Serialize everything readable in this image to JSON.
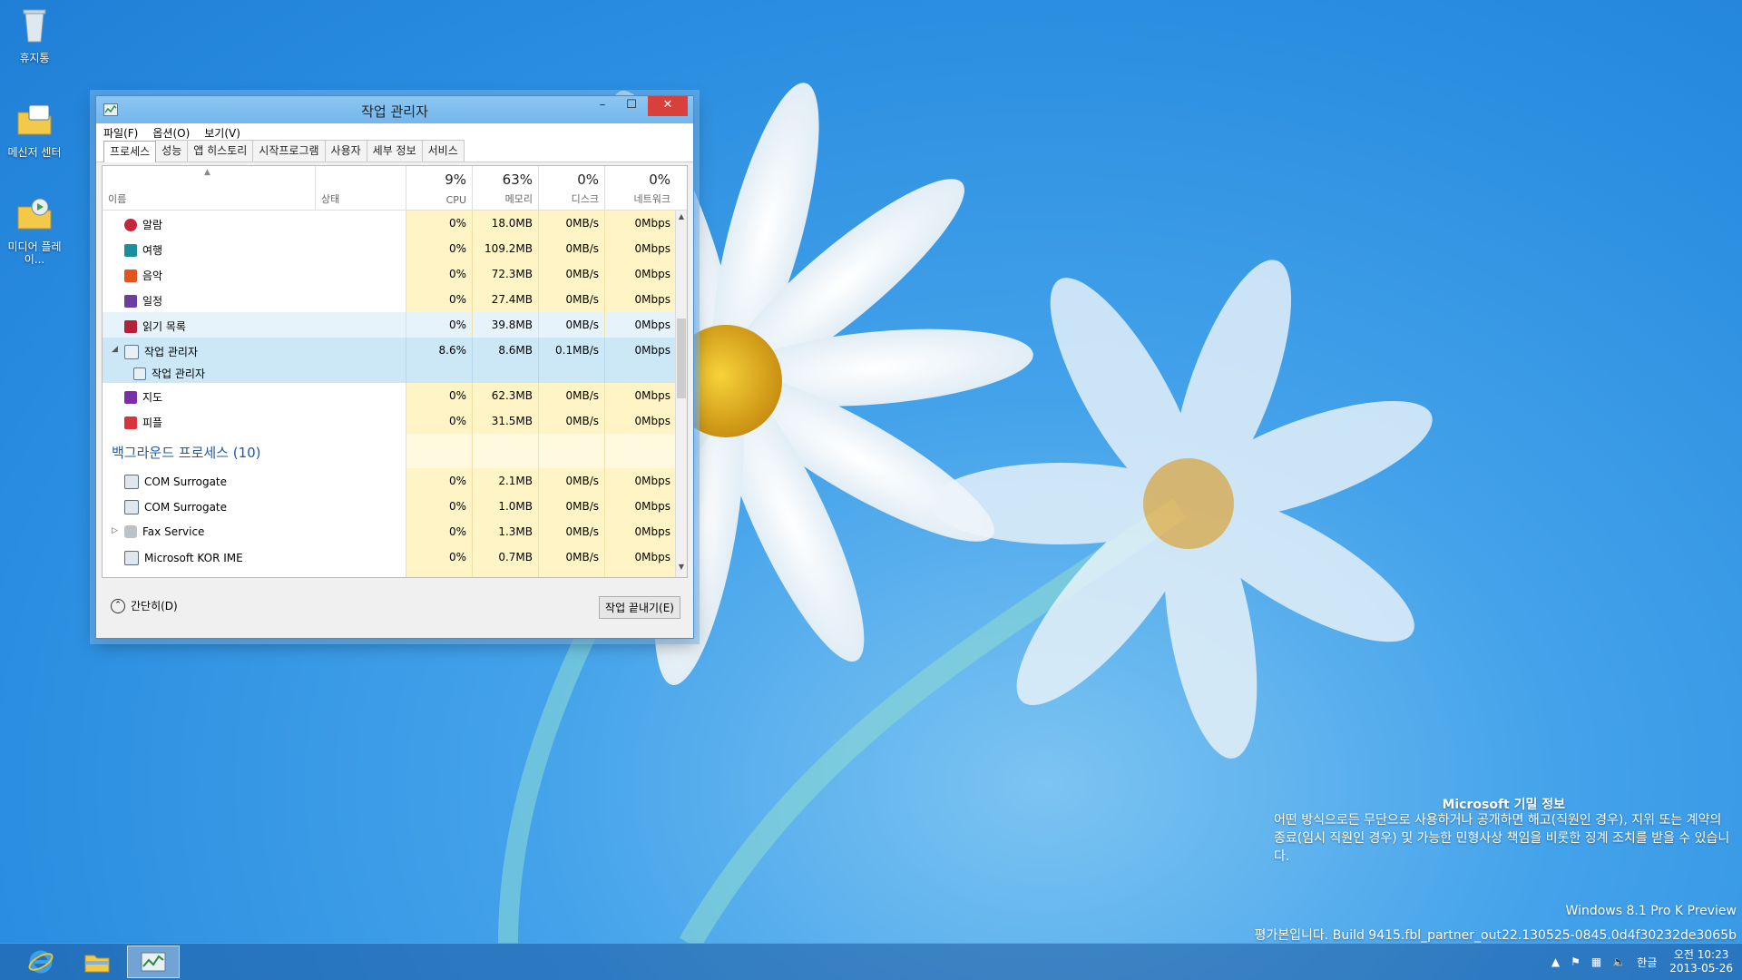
{
  "desktop": {
    "icons": [
      {
        "label": "휴지통",
        "icon": "recycle-bin-icon"
      },
      {
        "label": "메신저 센터",
        "icon": "messenger-center-icon"
      },
      {
        "label": "미디어 플레이...",
        "icon": "media-player-icon"
      }
    ]
  },
  "window": {
    "title": "작업 관리자",
    "controls": {
      "minimize": "–",
      "maximize": "☐",
      "close": "✕"
    },
    "menu": [
      "파일(F)",
      "옵션(O)",
      "보기(V)"
    ],
    "tabs": [
      "프로세스",
      "성능",
      "앱 히스토리",
      "시작프로그램",
      "사용자",
      "세부 정보",
      "서비스"
    ],
    "columns": {
      "name": "이름",
      "status": "상태",
      "cpu": {
        "pct": "9%",
        "label": "CPU"
      },
      "memory": {
        "pct": "63%",
        "label": "메모리"
      },
      "disk": {
        "pct": "0%",
        "label": "디스크"
      },
      "network": {
        "pct": "0%",
        "label": "네트워크"
      }
    },
    "apps": [
      {
        "name": "알람",
        "cpu": "0%",
        "mem": "18.0MB",
        "disk": "0MB/s",
        "net": "0Mbps",
        "color": "#c4263c"
      },
      {
        "name": "여행",
        "cpu": "0%",
        "mem": "109.2MB",
        "disk": "0MB/s",
        "net": "0Mbps",
        "color": "#1a8f9e"
      },
      {
        "name": "음악",
        "cpu": "0%",
        "mem": "72.3MB",
        "disk": "0MB/s",
        "net": "0Mbps",
        "color": "#e2541b"
      },
      {
        "name": "일정",
        "cpu": "0%",
        "mem": "27.4MB",
        "disk": "0MB/s",
        "net": "0Mbps",
        "color": "#6b3fa0"
      },
      {
        "name": "읽기 목록",
        "cpu": "0%",
        "mem": "39.8MB",
        "disk": "0MB/s",
        "net": "0Mbps",
        "color": "#b3223a"
      },
      {
        "name": "작업 관리자",
        "cpu": "8.6%",
        "mem": "8.6MB",
        "disk": "0.1MB/s",
        "net": "0Mbps",
        "color": "#7a9cc0",
        "child": "작업 관리자"
      },
      {
        "name": "지도",
        "cpu": "0%",
        "mem": "62.3MB",
        "disk": "0MB/s",
        "net": "0Mbps",
        "color": "#7a2fa8"
      },
      {
        "name": "피플",
        "cpu": "0%",
        "mem": "31.5MB",
        "disk": "0MB/s",
        "net": "0Mbps",
        "color": "#d6343f"
      }
    ],
    "background_section": "백그라운드 프로세스 (10)",
    "background": [
      {
        "name": "COM Surrogate",
        "cpu": "0%",
        "mem": "2.1MB",
        "disk": "0MB/s",
        "net": "0Mbps"
      },
      {
        "name": "COM Surrogate",
        "cpu": "0%",
        "mem": "1.0MB",
        "disk": "0MB/s",
        "net": "0Mbps"
      },
      {
        "name": "Fax Service",
        "cpu": "0%",
        "mem": "1.3MB",
        "disk": "0MB/s",
        "net": "0Mbps"
      },
      {
        "name": "Microsoft KOR IME",
        "cpu": "0%",
        "mem": "0.7MB",
        "disk": "0MB/s",
        "net": "0Mbps"
      }
    ],
    "fewer_details": "간단히(D)",
    "end_task": "작업 끝내기(E)"
  },
  "watermark": {
    "title": "Microsoft 기밀 정보",
    "body": "어떤 방식으로든 무단으로 사용하거나 공개하면 해고(직원인 경우), 지위 또는 계약의 종료(임시 직원인 경우) 및 가능한 민형사상 책임을 비롯한 징계 조치를 받을 수 있습니다.",
    "edition": "Windows 8.1 Pro K Preview",
    "build": "평가본입니다. Build 9415.fbl_partner_out22.130525-0845.0d4f30232de3065b"
  },
  "taskbar": {
    "ime": "한글",
    "time": "오전 10:23",
    "date": "2013-05-26"
  }
}
